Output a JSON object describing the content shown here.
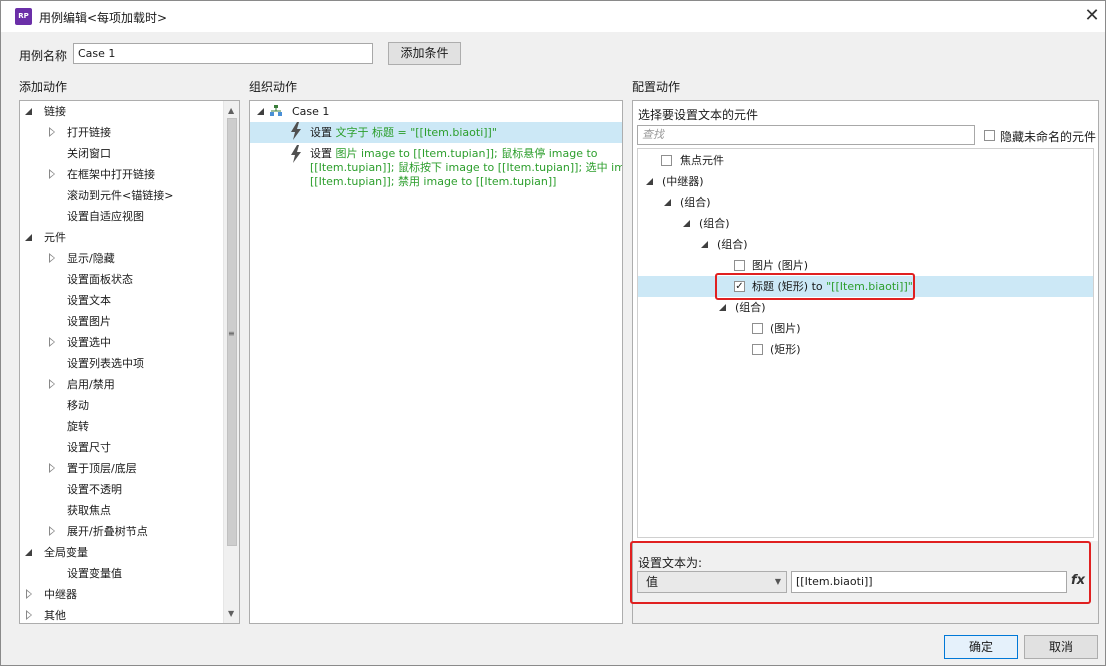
{
  "window": {
    "title": "用例编辑<每项加载时>",
    "app_icon": "RP",
    "close": "✕"
  },
  "case_name": {
    "label": "用例名称",
    "value": "Case 1",
    "add_condition": "添加条件"
  },
  "add_actions": {
    "heading": "添加动作",
    "items": [
      {
        "text": "链接",
        "level": 0,
        "expand": "open"
      },
      {
        "text": "打开链接",
        "level": 1,
        "expand": "closed"
      },
      {
        "text": "关闭窗口",
        "level": 1,
        "expand": "none"
      },
      {
        "text": "在框架中打开链接",
        "level": 1,
        "expand": "closed"
      },
      {
        "text": "滚动到元件<锚链接>",
        "level": 1,
        "expand": "none"
      },
      {
        "text": "设置自适应视图",
        "level": 1,
        "expand": "none"
      },
      {
        "text": "元件",
        "level": 0,
        "expand": "open"
      },
      {
        "text": "显示/隐藏",
        "level": 1,
        "expand": "closed"
      },
      {
        "text": "设置面板状态",
        "level": 1,
        "expand": "none"
      },
      {
        "text": "设置文本",
        "level": 1,
        "expand": "none"
      },
      {
        "text": "设置图片",
        "level": 1,
        "expand": "none"
      },
      {
        "text": "设置选中",
        "level": 1,
        "expand": "closed"
      },
      {
        "text": "设置列表选中项",
        "level": 1,
        "expand": "none"
      },
      {
        "text": "启用/禁用",
        "level": 1,
        "expand": "closed"
      },
      {
        "text": "移动",
        "level": 1,
        "expand": "none"
      },
      {
        "text": "旋转",
        "level": 1,
        "expand": "none"
      },
      {
        "text": "设置尺寸",
        "level": 1,
        "expand": "none"
      },
      {
        "text": "置于顶层/底层",
        "level": 1,
        "expand": "closed"
      },
      {
        "text": "设置不透明",
        "level": 1,
        "expand": "none"
      },
      {
        "text": "获取焦点",
        "level": 1,
        "expand": "none"
      },
      {
        "text": "展开/折叠树节点",
        "level": 1,
        "expand": "closed"
      },
      {
        "text": "全局变量",
        "level": 0,
        "expand": "open"
      },
      {
        "text": "设置变量值",
        "level": 1,
        "expand": "none"
      },
      {
        "text": "中继器",
        "level": 0,
        "expand": "closed"
      },
      {
        "text": "其他",
        "level": 0,
        "expand": "closed"
      }
    ]
  },
  "organize_actions": {
    "heading": "组织动作",
    "case_label": "Case 1",
    "action1": {
      "prefix": "设置 ",
      "green": "文字于 标题 = \"[[Item.biaoti]]\""
    },
    "action2": {
      "prefix": "设置 ",
      "line1_green": "图片 image to [[Item.tupian]]; 鼠标悬停 image to",
      "line2_green": "[[Item.tupian]]; 鼠标按下 image to [[Item.tupian]]; 选中 image to",
      "line3_green": "[[Item.tupian]]; 禁用 image to [[Item.tupian]]"
    }
  },
  "config_actions": {
    "heading": "配置动作",
    "select_label": "选择要设置文本的元件",
    "search_placeholder": "查找",
    "hide_unnamed": "隐藏未命名的元件",
    "tree": {
      "focus": "焦点元件",
      "repeater": "(中继器)",
      "group1": "(组合)",
      "group2": "(组合)",
      "group3": "(组合)",
      "image_item": "图片 (图片)",
      "title_item_prefix": "标题 (矩形) to ",
      "title_item_green": "\"[[Item.biaoti]]\"",
      "group4": "(组合)",
      "img2": "(图片)",
      "rect2": "(矩形)"
    },
    "set_text_label": "设置文本为:",
    "set_text_type": "值",
    "set_text_value": "[[Item.biaoti]]",
    "fx": "fx"
  },
  "footer": {
    "ok": "确定",
    "cancel": "取消"
  }
}
